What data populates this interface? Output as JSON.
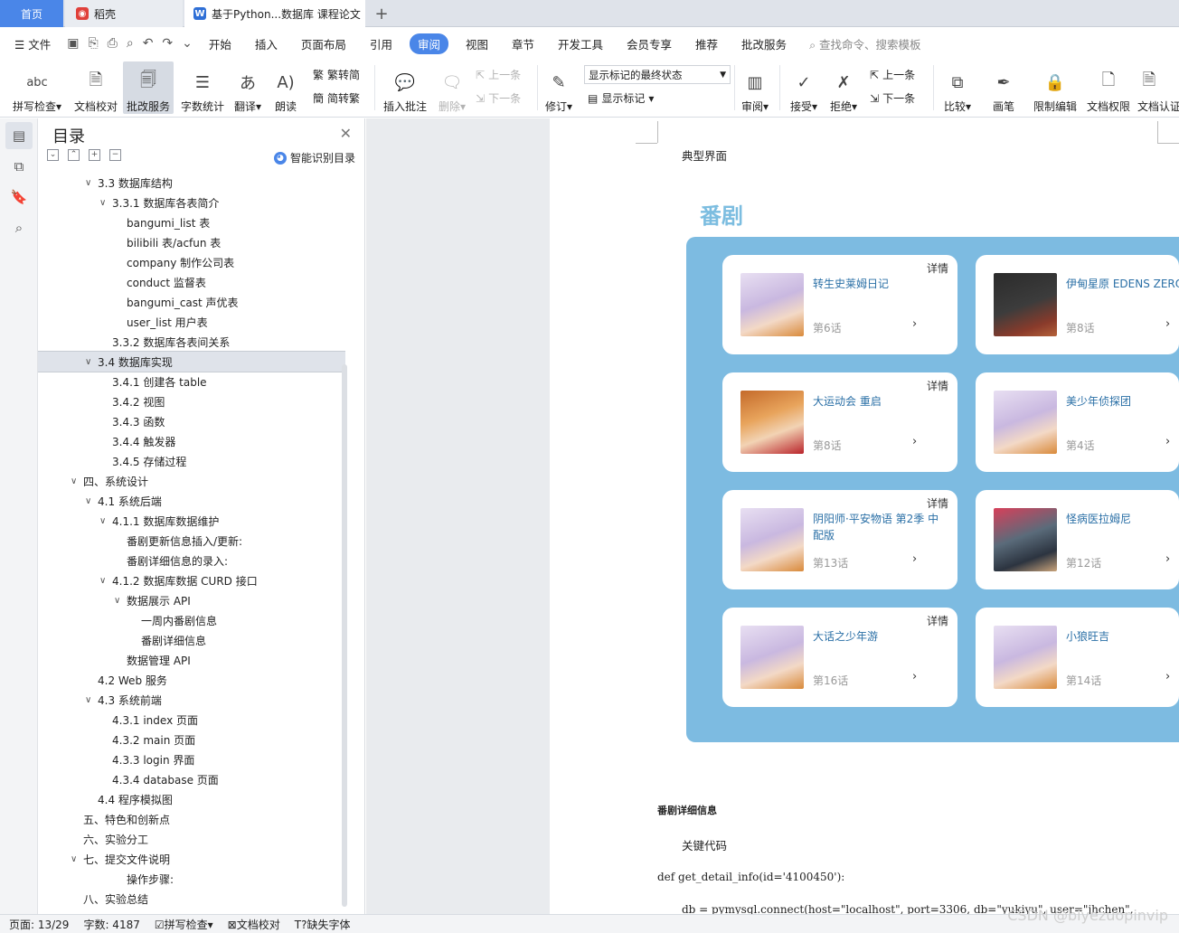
{
  "tabs": {
    "home": "首页",
    "docer": "稻壳",
    "doc": "基于Python...数据库 课程论文",
    "new": "+"
  },
  "menu": {
    "file": "文件",
    "items": [
      "开始",
      "插入",
      "页面布局",
      "引用",
      "审阅",
      "视图",
      "章节",
      "开发工具",
      "会员专享",
      "推荐",
      "批改服务"
    ],
    "active_index": 4,
    "search": "查找命令、搜索模板"
  },
  "ribbon": {
    "spell": "拼写检查",
    "proof": "文档校对",
    "review_service": "批改服务",
    "wordcount": "字数统计",
    "translate": "翻译",
    "read": "朗读",
    "trad": "繁转简",
    "simp": "简转繁",
    "insert_comment": "插入批注",
    "delete": "删除",
    "prev": "上一条",
    "next": "下一条",
    "revise": "修订",
    "markup_select": "显示标记的最终状态",
    "show_markup": "显示标记",
    "review": "审阅",
    "accept": "接受",
    "reject": "拒绝",
    "prev2": "上一条",
    "next2": "下一条",
    "compare": "比较",
    "pen": "画笔",
    "restrict": "限制编辑",
    "doc_perm": "文档权限",
    "doc_auth": "文档认证"
  },
  "toc": {
    "title": "目录",
    "smart": "智能识别目录",
    "items": [
      {
        "label": "3.3  数据库结构",
        "level": 1,
        "chev": "v"
      },
      {
        "label": "3.3.1  数据库各表简介",
        "level": 2,
        "chev": "v"
      },
      {
        "label": "bangumi_list 表",
        "level": 3,
        "chev": ""
      },
      {
        "label": "bilibili 表/acfun 表",
        "level": 3,
        "chev": ""
      },
      {
        "label": "company 制作公司表",
        "level": 3,
        "chev": ""
      },
      {
        "label": "conduct 监督表",
        "level": 3,
        "chev": ""
      },
      {
        "label": "bangumi_cast 声优表",
        "level": 3,
        "chev": ""
      },
      {
        "label": "user_list 用户表",
        "level": 3,
        "chev": ""
      },
      {
        "label": "3.3.2  数据库各表间关系",
        "level": 2,
        "chev": ""
      },
      {
        "label": "3.4  数据库实现",
        "level": 1,
        "chev": "v",
        "selected": true
      },
      {
        "label": "3.4.1  创建各 table",
        "level": 2,
        "chev": ""
      },
      {
        "label": "3.4.2  视图",
        "level": 2,
        "chev": ""
      },
      {
        "label": "3.4.3  函数",
        "level": 2,
        "chev": ""
      },
      {
        "label": "3.4.4  触发器",
        "level": 2,
        "chev": ""
      },
      {
        "label": "3.4.5  存储过程",
        "level": 2,
        "chev": ""
      },
      {
        "label": "四、系统设计",
        "level": 0,
        "chev": "v"
      },
      {
        "label": "4.1  系统后端",
        "level": 1,
        "chev": "v"
      },
      {
        "label": "4.1.1  数据库数据维护",
        "level": 2,
        "chev": "v"
      },
      {
        "label": "番剧更新信息插入/更新:",
        "level": 3,
        "chev": ""
      },
      {
        "label": "番剧详细信息的录入:",
        "level": 3,
        "chev": ""
      },
      {
        "label": "4.1.2  数据库数据 CURD 接口",
        "level": 2,
        "chev": "v"
      },
      {
        "label": "数据展示 API",
        "level": 3,
        "chev": "v"
      },
      {
        "label": "一周内番剧信息",
        "level": 4,
        "chev": ""
      },
      {
        "label": "番剧详细信息",
        "level": 4,
        "chev": ""
      },
      {
        "label": "数据管理 API",
        "level": 3,
        "chev": ""
      },
      {
        "label": "4.2 Web 服务",
        "level": 1,
        "chev": ""
      },
      {
        "label": "4.3  系统前端",
        "level": 1,
        "chev": "v"
      },
      {
        "label": "4.3.1 index 页面",
        "level": 2,
        "chev": ""
      },
      {
        "label": "4.3.2 main 页面",
        "level": 2,
        "chev": ""
      },
      {
        "label": "4.3.3 login 界面",
        "level": 2,
        "chev": ""
      },
      {
        "label": "4.3.4 database 页面",
        "level": 2,
        "chev": ""
      },
      {
        "label": "4.4  程序模拟图",
        "level": 1,
        "chev": ""
      },
      {
        "label": "五、特色和创新点",
        "level": 0,
        "chev": ""
      },
      {
        "label": "六、实验分工",
        "level": 0,
        "chev": ""
      },
      {
        "label": "七、提交文件说明",
        "level": 0,
        "chev": "v"
      },
      {
        "label": "操作步骤:",
        "level": 3,
        "chev": ""
      },
      {
        "label": "八、实验总结",
        "level": 0,
        "chev": ""
      }
    ]
  },
  "doc": {
    "heading": "典型界面",
    "fan_title": "番剧",
    "cards": [
      {
        "title": "转生史莱姆日记",
        "ep": "第6话",
        "detail": "详情",
        "thumb": "purple"
      },
      {
        "title": "伊甸星原 EDENS ZERO",
        "ep": "第8话",
        "detail": "",
        "thumb": "dark"
      },
      {
        "title": "大运动会 重启",
        "ep": "第8话",
        "detail": "详情",
        "thumb": "orange"
      },
      {
        "title": "美少年侦探团",
        "ep": "第4话",
        "detail": "",
        "thumb": "purple"
      },
      {
        "title": "阴阳师·平安物语 第2季 中配版",
        "ep": "第13话",
        "detail": "详情",
        "thumb": "purple"
      },
      {
        "title": "怪病医拉姆尼",
        "ep": "第12话",
        "detail": "",
        "thumb": "red"
      },
      {
        "title": "大话之少年游",
        "ep": "第16话",
        "detail": "详情",
        "thumb": "purple"
      },
      {
        "title": "小狼旺吉",
        "ep": "第14话",
        "detail": "",
        "thumb": "purple"
      }
    ],
    "arrow": "›",
    "subheading": "番剧详细信息",
    "key_code": "关键代码",
    "code1": "def get_detail_info(id='4100450'):",
    "code2": "db = pymysql.connect(host=\"localhost\", port=3306, db=\"yukiyu\", user=\"jhchen\","
  },
  "status": {
    "page": "页面: 13/29",
    "words": "字数: 4187",
    "spell": "拼写检查",
    "proof": "文档校对",
    "font": "缺失字体"
  },
  "watermark": "CSDN @biyezuopinvip",
  "colors": {
    "accent": "#4a86e8",
    "panel_blue": "#7dbbe1",
    "card_title": "#2a6fa6"
  }
}
